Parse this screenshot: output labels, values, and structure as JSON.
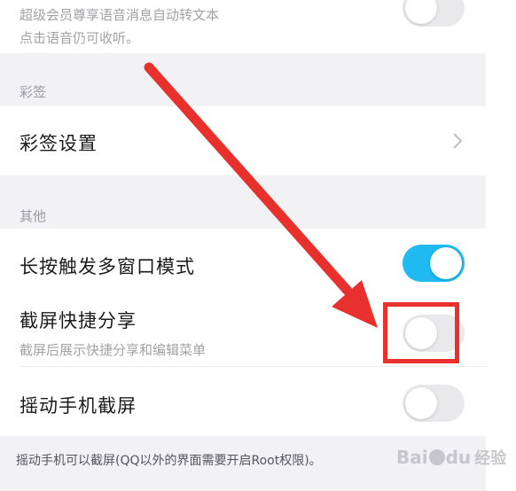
{
  "voice_setting": {
    "desc_line1": "超级会员尊享语音消息自动转文本",
    "desc_line2": "点击语音仍可收听。",
    "toggle_state": "off"
  },
  "caiqian_section": {
    "title": "彩签",
    "settings_label": "彩签设置"
  },
  "other_section": {
    "title": "其他",
    "long_press_label": "长按触发多窗口模式",
    "long_press_state": "on",
    "screenshot_share_label": "截屏快捷分享",
    "screenshot_share_desc": "截屏后展示快捷分享和编辑菜单",
    "screenshot_share_state": "off",
    "shake_label": "摇动手机截屏",
    "shake_state": "off"
  },
  "footer_note": "摇动手机可以截屏(QQ以外的界面需要开启Root权限)。",
  "watermark": {
    "brand": "Bai",
    "brand_end": "du",
    "sub": "经验"
  },
  "colors": {
    "toggle_on": "#1ebaf1",
    "toggle_off": "#e9e9ec",
    "annotation_red": "#e8302c"
  }
}
